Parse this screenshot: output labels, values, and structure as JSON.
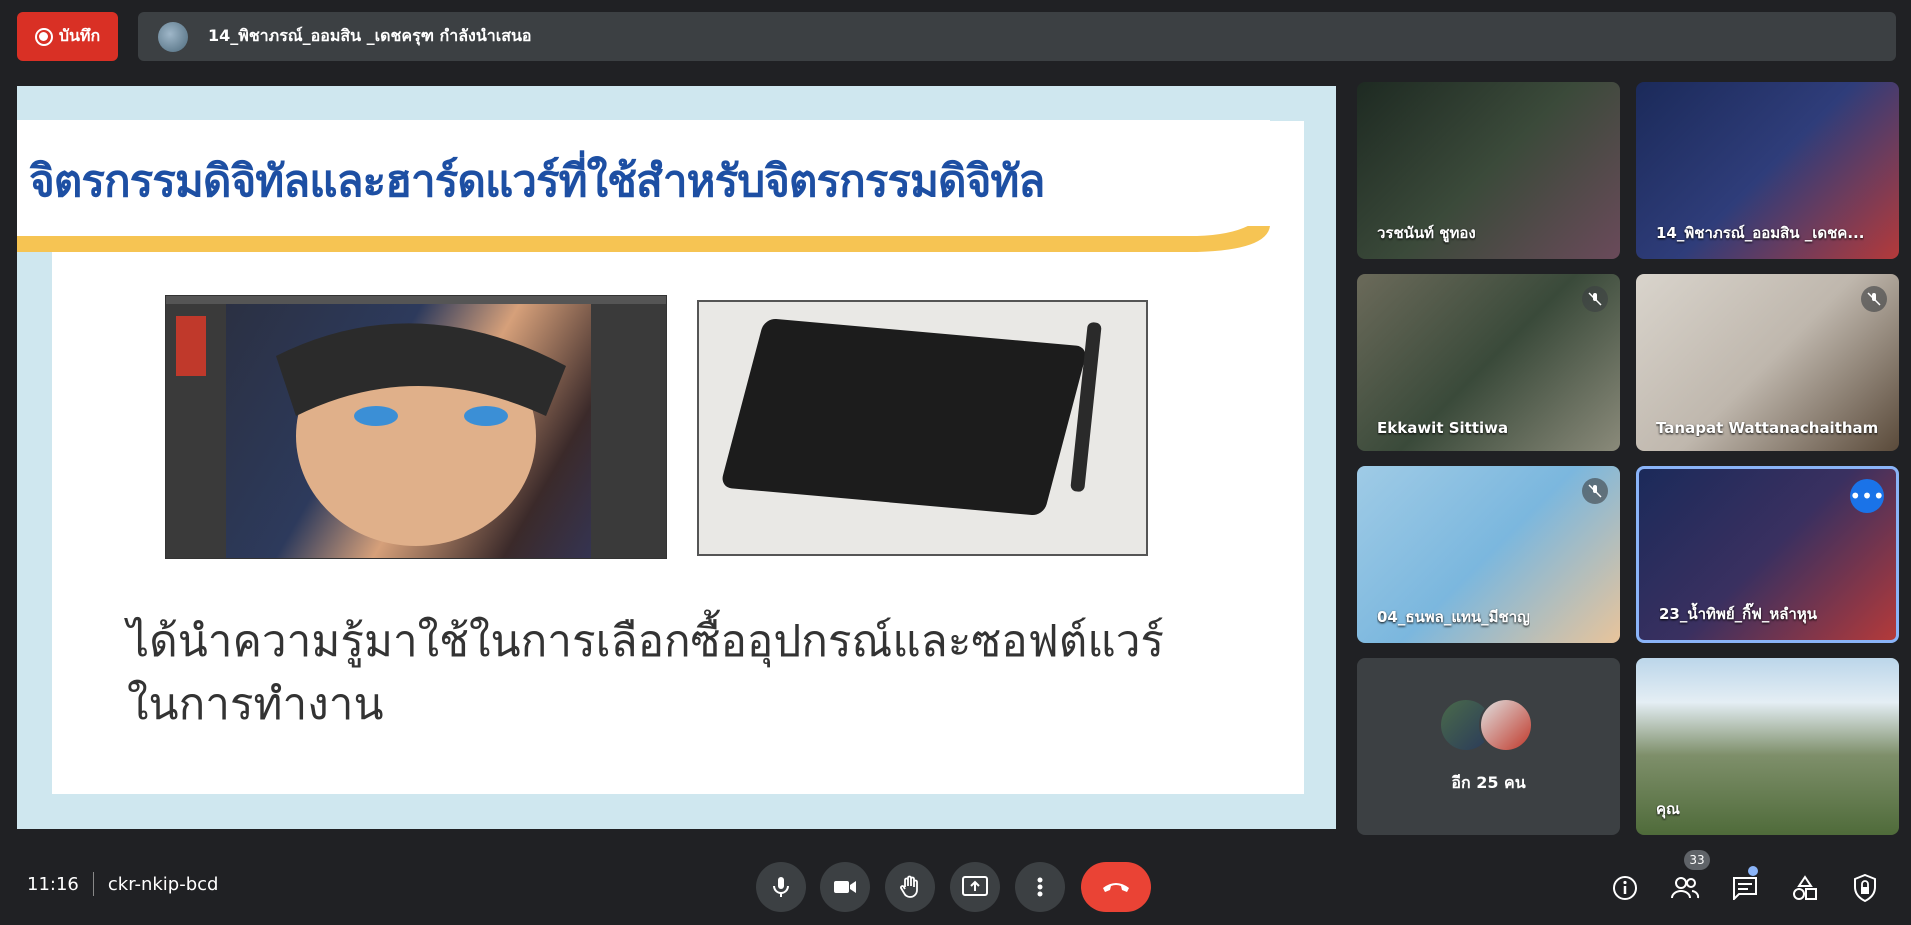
{
  "top": {
    "record_label": "บันทึก",
    "presenter_text": "14_พิชาภรณ์_ออมสิน _เดชครุฑ กำลังนำเสนอ"
  },
  "slide": {
    "title": "จิตรกรรมดิจิทัลและฮาร์ดแวร์ที่ใช้สำหรับจิตรกรรมดิจิทัล",
    "body_line1": "ได้นำความรู้มาใช้ในการเลือกซื้ออุปกรณ์และซอฟต์แวร์",
    "body_line2": "ในการทำงาน",
    "title_color": "#1d4fa3",
    "accent_color": "#f6c453"
  },
  "participants": [
    {
      "name": "วรชนันท์ ชูทอง",
      "muted": false
    },
    {
      "name": "14_พิชาภรณ์_ออมสิน _เดชค...",
      "muted": false
    },
    {
      "name": "Ekkawit Sittiwa",
      "muted": true
    },
    {
      "name": "Tanapat Wattanachaitham",
      "muted": true
    },
    {
      "name": "04_ธนพล_แทน_มีชาญ",
      "muted": true
    },
    {
      "name": "23_น้ำทิพย์_กิ๊ฟ_หลำหุน",
      "speaking": true
    },
    {
      "name": "คุณ",
      "muted": false
    }
  ],
  "others_tile": {
    "label": "อีก 25 คน"
  },
  "bottom": {
    "time": "11:16",
    "meeting_code": "ckr-nkip-bcd",
    "participant_count": "33"
  },
  "colors": {
    "background": "#202124",
    "tile": "#3c4043",
    "hangup": "#ea4335",
    "record": "#d93025",
    "active_speaker": "#8ab4f8"
  },
  "icons": [
    "mic-icon",
    "camera-icon",
    "hand-icon",
    "present-icon",
    "more-vert-icon",
    "hangup-icon",
    "info-icon",
    "people-icon",
    "chat-icon",
    "activities-icon",
    "host-controls-icon"
  ]
}
